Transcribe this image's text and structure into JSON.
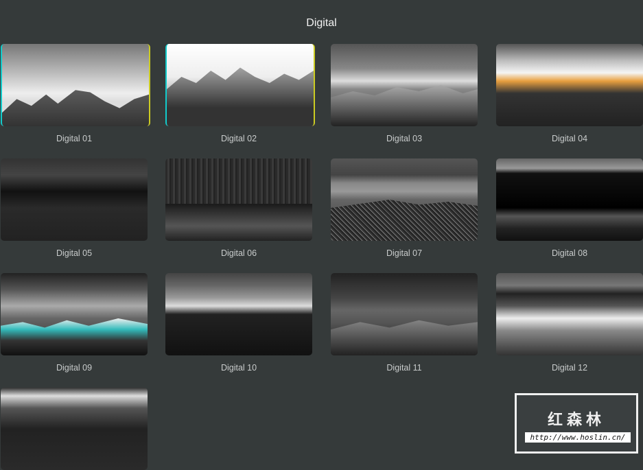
{
  "header": {
    "title": "Digital"
  },
  "items": [
    {
      "label": "Digital 01"
    },
    {
      "label": "Digital 02"
    },
    {
      "label": "Digital 03"
    },
    {
      "label": "Digital 04"
    },
    {
      "label": "Digital 05"
    },
    {
      "label": "Digital 06"
    },
    {
      "label": "Digital 07"
    },
    {
      "label": "Digital 08"
    },
    {
      "label": "Digital 09"
    },
    {
      "label": "Digital 10"
    },
    {
      "label": "Digital 11"
    },
    {
      "label": "Digital 12"
    },
    {
      "label": ""
    }
  ],
  "watermark": {
    "name": "红森林",
    "url": "http://www.hoslin.cn/"
  }
}
